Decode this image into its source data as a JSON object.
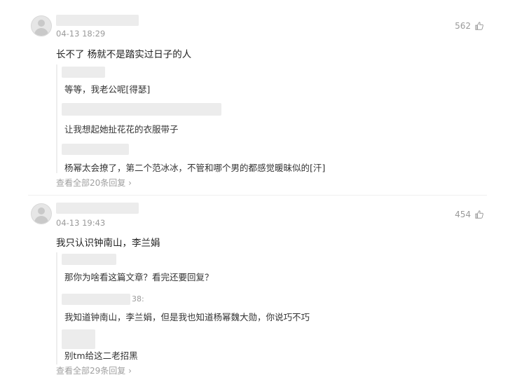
{
  "comments": [
    {
      "time": "04-13 18:29",
      "likes": "562",
      "text": "长不了 杨就不是踏实过日子的人",
      "replies": [
        {
          "text": "等等，我老公呢[得瑟]"
        },
        {
          "text": "让我想起她扯花花的衣服带子"
        },
        {
          "text": "杨幂太会撩了，第二个范冰冰，不管和哪个男的都感觉暖昧似的[汗]"
        }
      ],
      "more": "查看全部20条回复 ›"
    },
    {
      "time": "04-13 19:43",
      "likes": "454",
      "text": "我只认识钟南山，李兰娟",
      "replies": [
        {
          "text": "那你为啥看这篇文章？看完还要回复？",
          "user_fragment": ""
        },
        {
          "text": "我知道钟南山，李兰娟，但是我也知道杨幂魏大勋，你说巧不巧",
          "user_fragment": "38:"
        },
        {
          "text": "别tm给这二老招黑"
        }
      ],
      "more": "查看全部29条回复 ›"
    }
  ],
  "icons": {
    "like": "thumb-up-icon",
    "avatar": "default-avatar-icon"
  },
  "colors": {
    "meta": "#9a9a9a",
    "text": "#222222",
    "blur": "#ececec"
  }
}
